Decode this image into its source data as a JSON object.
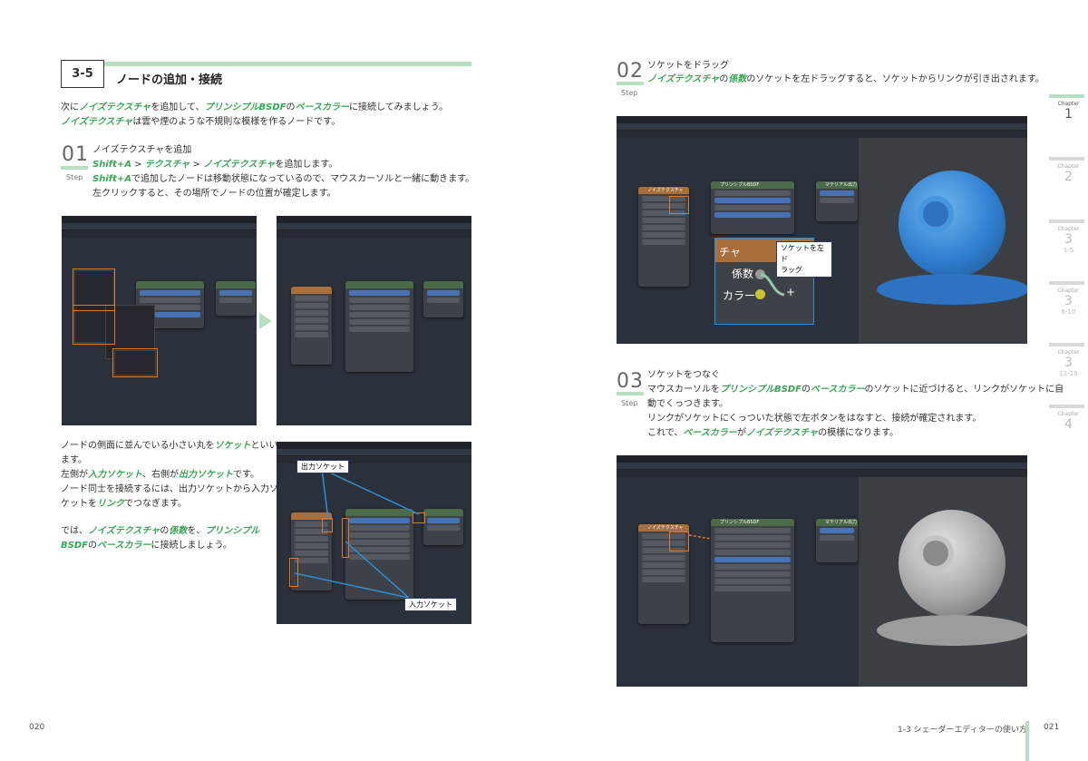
{
  "section": {
    "number": "3-5",
    "title": "ノードの追加・接続"
  },
  "intro": {
    "line1": [
      "次に",
      "ノイズテクスチャ",
      "を追加して、",
      "プリンシプルBSDF",
      "の",
      "ベースカラー",
      "に接続してみましょう。"
    ],
    "line2": [
      "ノイズテクスチャ",
      "は雲や煙のような不規則な模様を作るノードです。"
    ]
  },
  "step01": {
    "num": "01",
    "label": "Step",
    "title": "ノイズテクスチャを追加",
    "line1": [
      "Shift+A",
      " > ",
      "テクスチャ",
      " > ",
      "ノイズテクスチャ",
      "を追加します。"
    ],
    "line2": [
      "Shift+A",
      "で追加したノードは移動状態になっているので、マウスカーソルと一緒に動きます。"
    ],
    "line3": "左クリックすると、その場所でノードの位置が確定します。"
  },
  "body_left": {
    "p1": [
      "ノードの側面に並んでいる小さい丸を",
      "ソケット",
      "といい"
    ],
    "p2": "ます。",
    "p3": [
      "左側が",
      "入力ソケット",
      "、右側が",
      "出力ソケット",
      "です。"
    ],
    "p4": "ノード同士を接続するには、出力ソケットから入力ソ",
    "p5": [
      "ケットを",
      "リンク",
      "でつなぎます。"
    ],
    "p6": [
      "では、",
      "ノイズテクスチャ",
      "の",
      "係数",
      "を、",
      "プリンシプル"
    ],
    "p7": [
      "BSDF",
      "の",
      "ベースカラー",
      "に接続しましょう。"
    ]
  },
  "callouts": {
    "output_socket": "出力ソケット",
    "input_socket": "入力ソケット",
    "drag_socket_1": "ソケットを左ド",
    "drag_socket_2": "ラッグ"
  },
  "zoom": {
    "fac": "係数",
    "color": "カラー",
    "tex_partial": "チャ"
  },
  "nodes": {
    "noise": "ノイズテクスチャ",
    "principled": "プリンシプルBSDF",
    "output": "マテリアル出力"
  },
  "step02": {
    "num": "02",
    "label": "Step",
    "title": "ソケットをドラッグ",
    "line1": [
      "ノイズテクスチャ",
      "の",
      "係数",
      "のソケットを左ドラッグすると、ソケットからリンクが引き出されます。"
    ]
  },
  "step03": {
    "num": "03",
    "label": "Step",
    "title": "ソケットをつなぐ",
    "line1": [
      "マウスカーソルを",
      "プリンシプルBSDF",
      "の",
      "ベースカラー",
      "のソケットに近づけると、リンクがソケットに自"
    ],
    "line2": "動でくっつきます。",
    "line3": "リンクがソケットにくっついた状態で左ボタンをはなすと、接続が確定されます。",
    "line4": [
      "これで、",
      "ベースカラー",
      "が",
      "ノイズテクスチャ",
      "の模様になります。"
    ]
  },
  "tabs": [
    {
      "label": "Chapter",
      "num": "1",
      "sub": ""
    },
    {
      "label": "Chapter",
      "num": "2",
      "sub": ""
    },
    {
      "label": "Chapter",
      "num": "3",
      "sub": "1-5"
    },
    {
      "label": "Chapter",
      "num": "3",
      "sub": "6-10"
    },
    {
      "label": "Chapter",
      "num": "3",
      "sub": "11-15"
    },
    {
      "label": "Chapter",
      "num": "4",
      "sub": ""
    }
  ],
  "footer": {
    "left_page": "020",
    "right_page": "021",
    "chapter_title": "1-3 シェーダーエディターの使い方"
  },
  "colors": {
    "accent_green": "#3aa657",
    "bar_green": "#b7dfc1",
    "highlight_orange": "#e07a2a",
    "callout_blue": "#2e8fd6"
  }
}
